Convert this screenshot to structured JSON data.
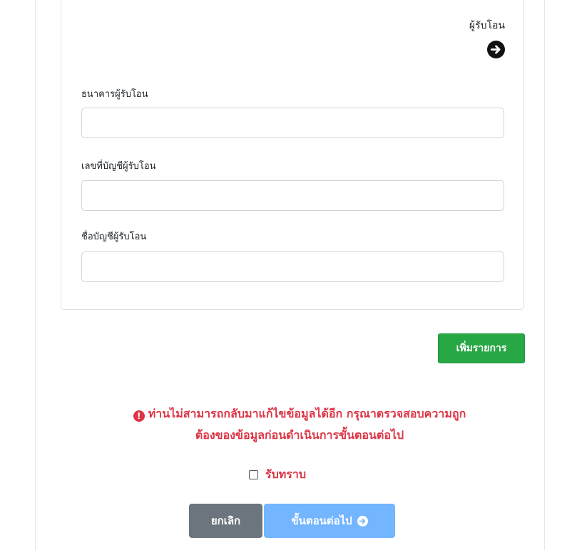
{
  "recipient": {
    "heading": "ผู้รับโอน",
    "icon": "arrow-circle-right-icon"
  },
  "fields": [
    {
      "label": "ธนาคารผู้รับโอน",
      "value": ""
    },
    {
      "label": "เลขที่บัญชีผู้รับโอน",
      "value": ""
    },
    {
      "label": "ชื่อบัญชีผู้รับโอน",
      "value": ""
    }
  ],
  "add_button": "เพิ่มรายการ",
  "warning": {
    "icon": "exclamation-circle-icon",
    "line1": "ท่านไม่สามารถกลับมาแก้ไขข้อมูลได้อีก กรุณาตรวจสอบความถูก",
    "line2": "ต้องของข้อมูลก่อนดำเนินการขั้นตอนต่อไป"
  },
  "acknowledge": {
    "label": "รับทราบ",
    "checked": false
  },
  "actions": {
    "cancel": "ยกเลิก",
    "next": "ขั้นตอนต่อไป",
    "next_icon": "arrow-circle-right-icon"
  },
  "colors": {
    "success": "#28a745",
    "danger": "#dc3545",
    "secondary": "#6c757d",
    "primary_light": "#73b5ff",
    "border": "#ced4da"
  }
}
